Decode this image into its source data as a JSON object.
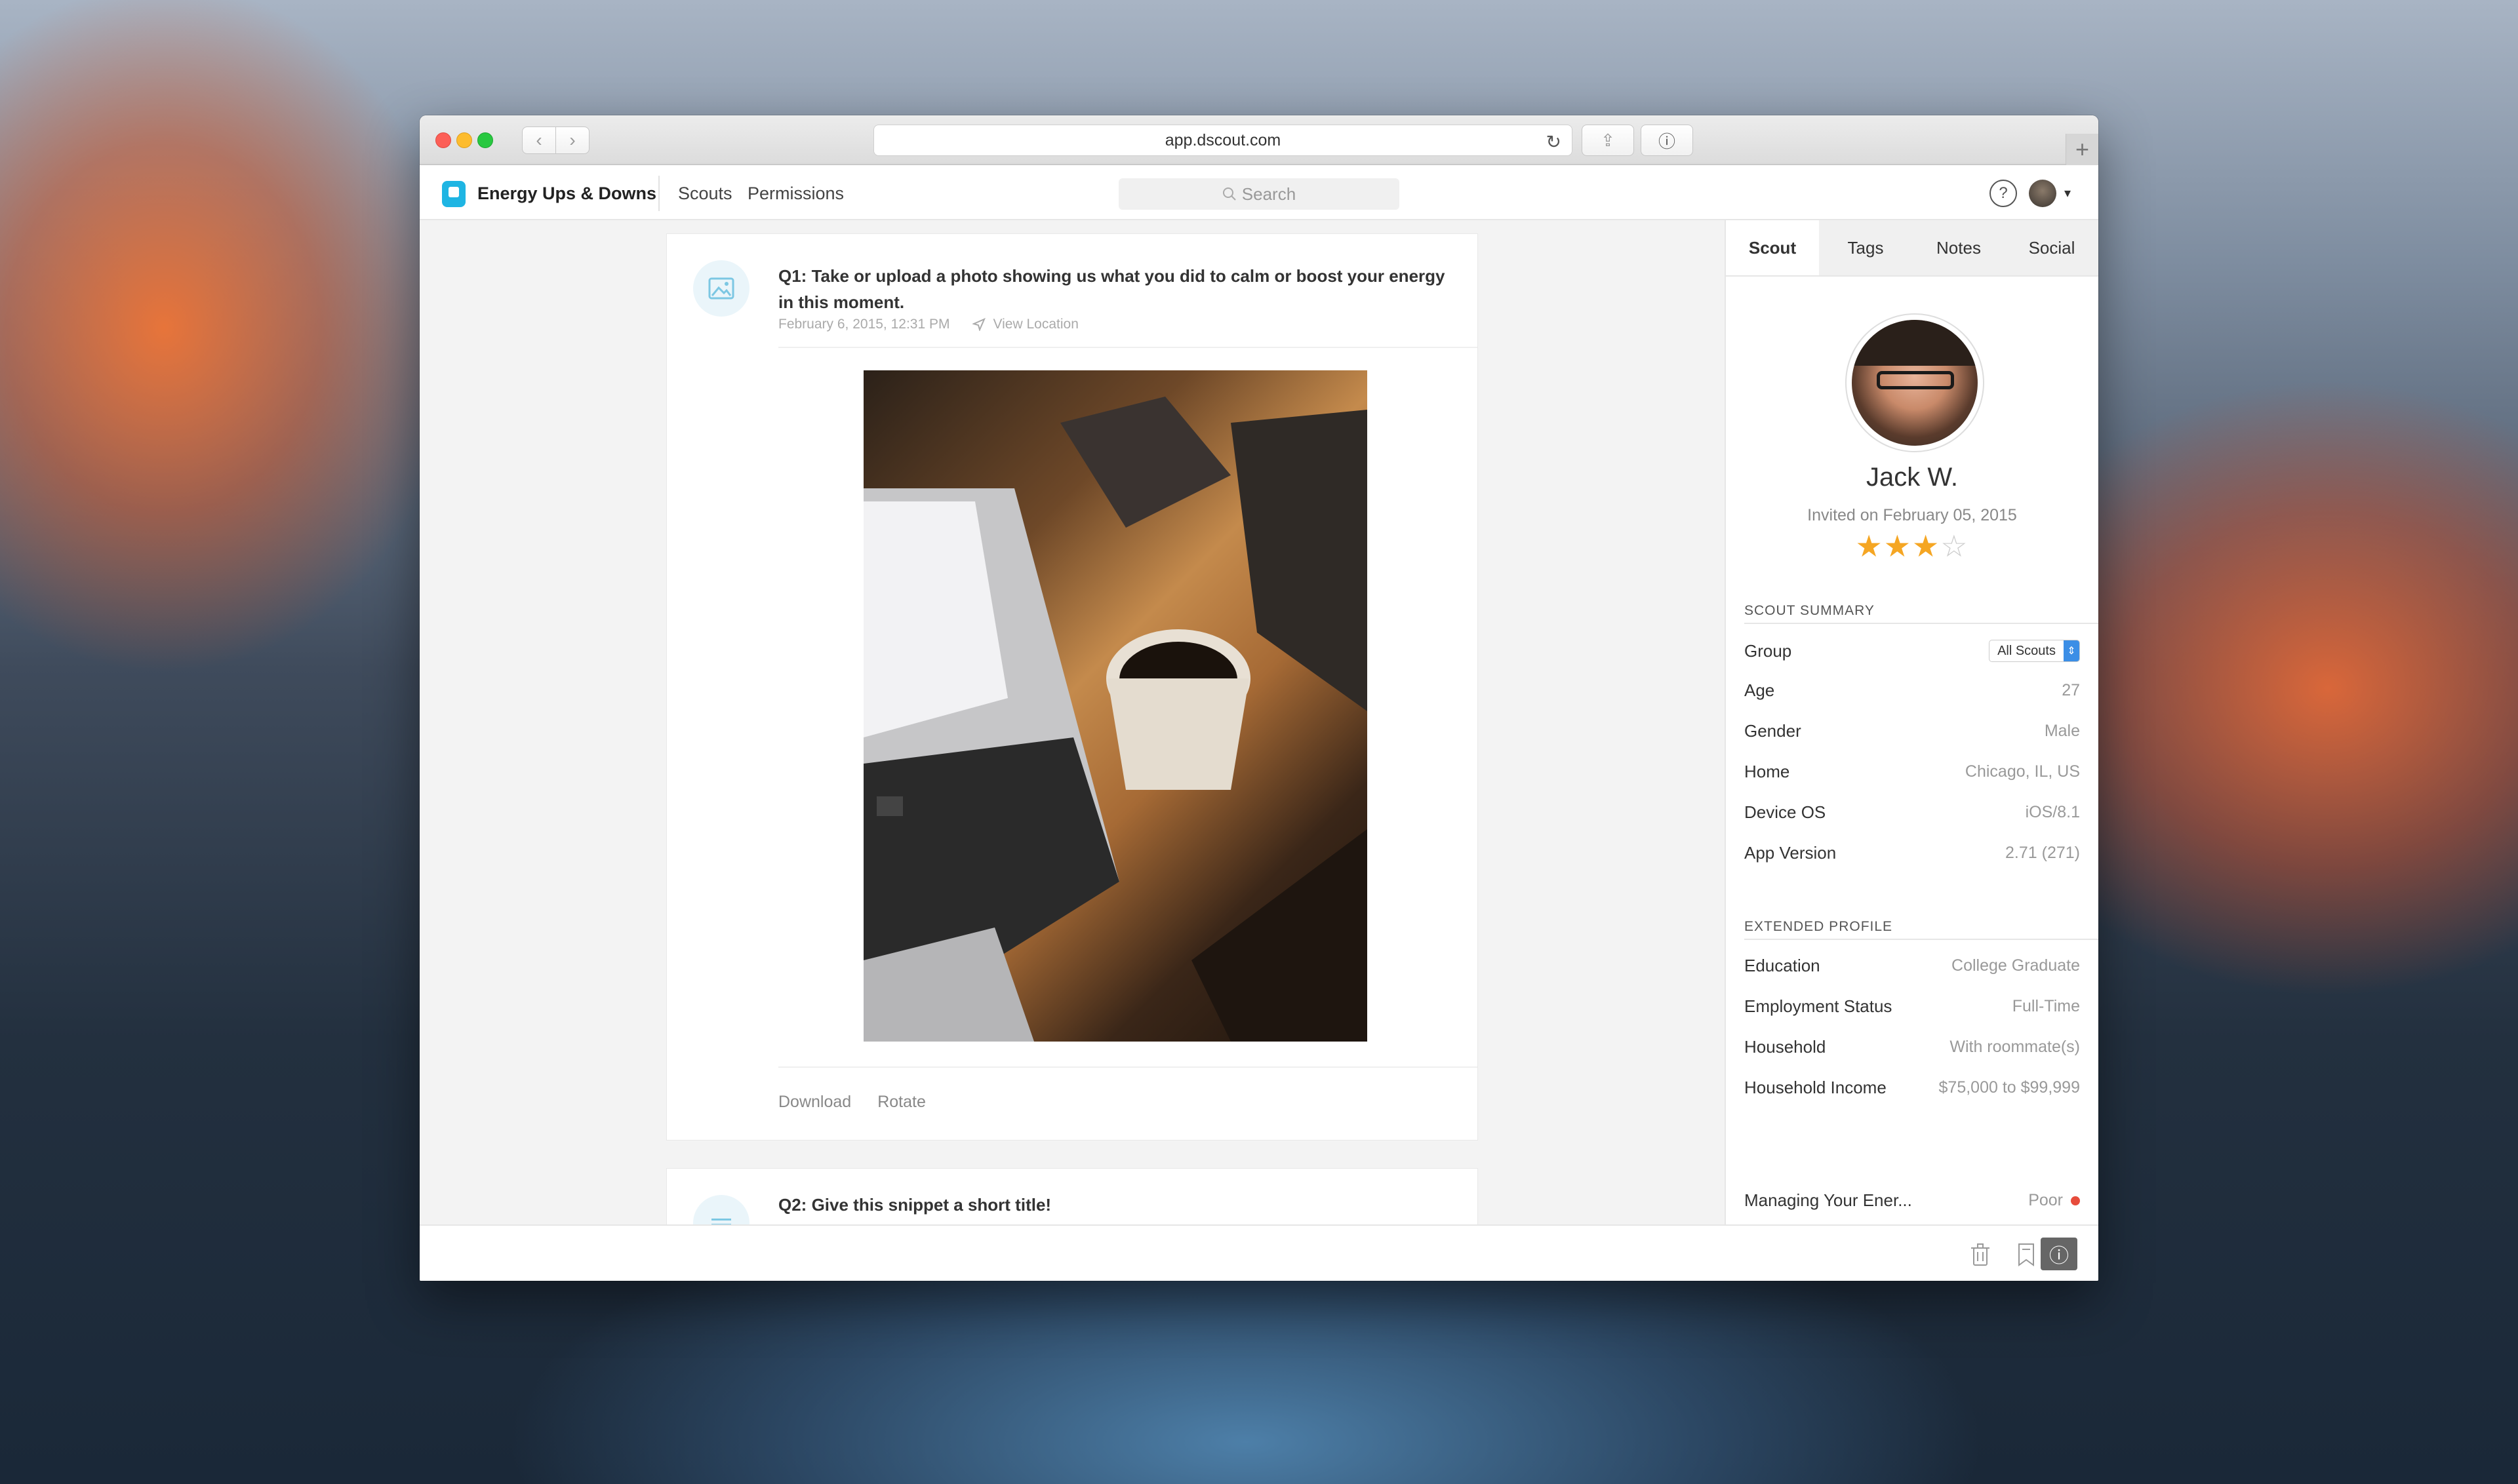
{
  "browser": {
    "url": "app.dscout.com",
    "back_glyph": "‹",
    "forward_glyph": "›",
    "reload_glyph": "↻",
    "share_glyph": "⇪",
    "info_glyph": "ⓘ",
    "newtab_glyph": "+"
  },
  "header": {
    "project_title": "Energy Ups & Downs",
    "nav": {
      "scouts": "Scouts",
      "permissions": "Permissions"
    },
    "search_placeholder": "Search",
    "help_glyph": "?",
    "caret_glyph": "▾"
  },
  "entries": [
    {
      "question": "Q1: Take or upload a photo showing us what you did to calm or boost your energy in this moment.",
      "timestamp": "February 6, 2015, 12:31 PM",
      "location_label": "View Location",
      "actions": {
        "download": "Download",
        "rotate": "Rotate"
      }
    },
    {
      "question": "Q2: Give this snippet a short title!"
    }
  ],
  "sidebar": {
    "tabs": [
      "Scout",
      "Tags",
      "Notes",
      "Social"
    ],
    "active_tab": "Scout",
    "scout_name": "Jack W.",
    "invited": "Invited on February 05, 2015",
    "rating": 3,
    "rating_max": 4,
    "summary_heading": "SCOUT SUMMARY",
    "summary": {
      "group_label": "Group",
      "group_value": "All Scouts",
      "age_label": "Age",
      "age_value": "27",
      "gender_label": "Gender",
      "gender_value": "Male",
      "home_label": "Home",
      "home_value": "Chicago, IL, US",
      "os_label": "Device OS",
      "os_value": "iOS/8.1",
      "app_label": "App Version",
      "app_value": "2.71 (271)"
    },
    "extended_heading": "EXTENDED PROFILE",
    "extended": {
      "education_label": "Education",
      "education_value": "College Graduate",
      "employment_label": "Employment Status",
      "employment_value": "Full-Time",
      "household_label": "Household",
      "household_value": "With roommate(s)",
      "income_label": "Household Income",
      "income_value": "$75,000 to $99,999"
    },
    "managing_label": "Managing Your Ener...",
    "managing_value": "Poor",
    "status_color": "#e74c3c"
  },
  "bottom": {
    "trash_glyph": "🗑",
    "bookmark_glyph": "🔖",
    "info_glyph": "ⓘ"
  },
  "colors": {
    "accent": "#1fb5e3",
    "star": "#f5a623"
  }
}
